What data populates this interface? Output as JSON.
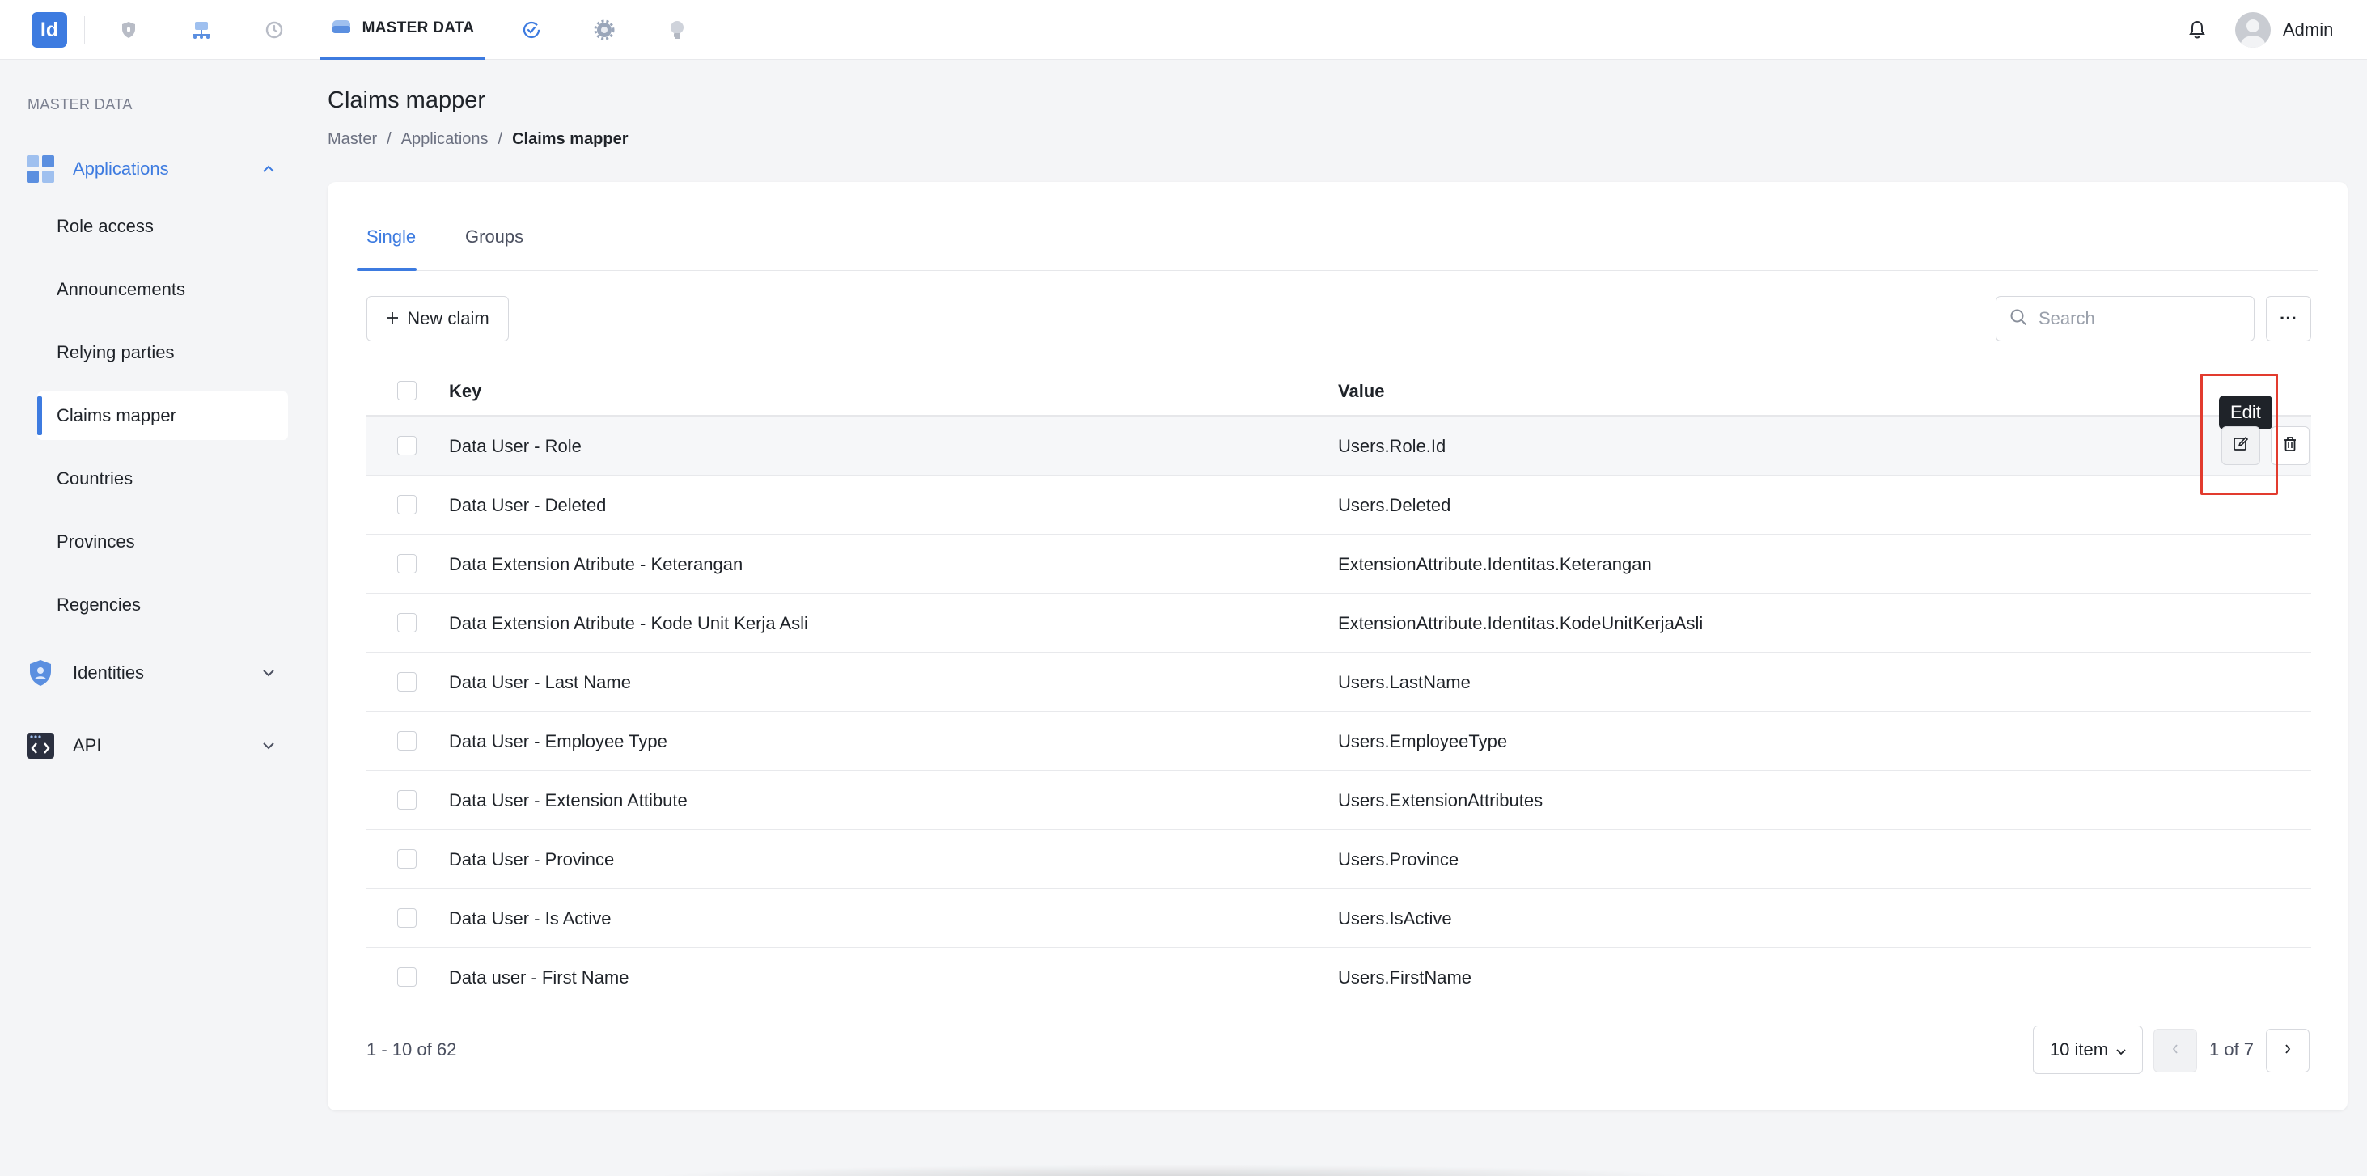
{
  "topbar": {
    "logo_text": "Id",
    "nav_icons": [
      "shield-icon",
      "network-icon",
      "history-icon",
      "database-icon",
      "check-circle-icon",
      "gear-icon",
      "bulb-icon"
    ],
    "active_nav_label": "MASTER DATA",
    "user_name": "Admin",
    "accent_color": "#3d7be0"
  },
  "sidebar": {
    "section_title": "MASTER DATA",
    "groups": [
      {
        "label": "Applications",
        "expanded": true
      },
      {
        "label": "Identities",
        "expanded": false
      },
      {
        "label": "API",
        "expanded": false
      }
    ],
    "items": [
      {
        "label": "Role access"
      },
      {
        "label": "Announcements"
      },
      {
        "label": "Relying parties"
      },
      {
        "label": "Claims mapper"
      },
      {
        "label": "Countries"
      },
      {
        "label": "Provinces"
      },
      {
        "label": "Regencies"
      }
    ],
    "active_item": "Claims mapper"
  },
  "page": {
    "title": "Claims mapper",
    "breadcrumb": [
      "Master",
      "Applications",
      "Claims mapper"
    ]
  },
  "tabs": [
    {
      "label": "Single",
      "active": true
    },
    {
      "label": "Groups",
      "active": false
    }
  ],
  "toolbar": {
    "new_label": "New claim",
    "search_placeholder": "Search",
    "more_label": "···"
  },
  "table": {
    "columns": [
      "Key",
      "Value"
    ],
    "rows": [
      {
        "key": "Data User - Role",
        "value": "Users.Role.Id"
      },
      {
        "key": "Data User - Deleted",
        "value": "Users.Deleted"
      },
      {
        "key": "Data Extension Atribute - Keterangan",
        "value": "ExtensionAttribute.Identitas.Keterangan"
      },
      {
        "key": "Data Extension Atribute - Kode Unit Kerja Asli",
        "value": "ExtensionAttribute.Identitas.KodeUnitKerjaAsli"
      },
      {
        "key": "Data User - Last Name",
        "value": "Users.LastName"
      },
      {
        "key": "Data User - Employee Type",
        "value": "Users.EmployeeType"
      },
      {
        "key": "Data User - Extension Attibute",
        "value": "Users.ExtensionAttributes"
      },
      {
        "key": "Data User - Province",
        "value": "Users.Province"
      },
      {
        "key": "Data User - Is Active",
        "value": "Users.IsActive"
      },
      {
        "key": "Data user - First Name",
        "value": "Users.FirstName"
      }
    ],
    "row_actions": {
      "edit_tooltip": "Edit"
    }
  },
  "pagination": {
    "range_text": "1 - 10 of 62",
    "per_page_label": "10 item",
    "page_label": "1 of 7"
  },
  "annotation": {
    "highlight_color": "#e23b2e"
  }
}
